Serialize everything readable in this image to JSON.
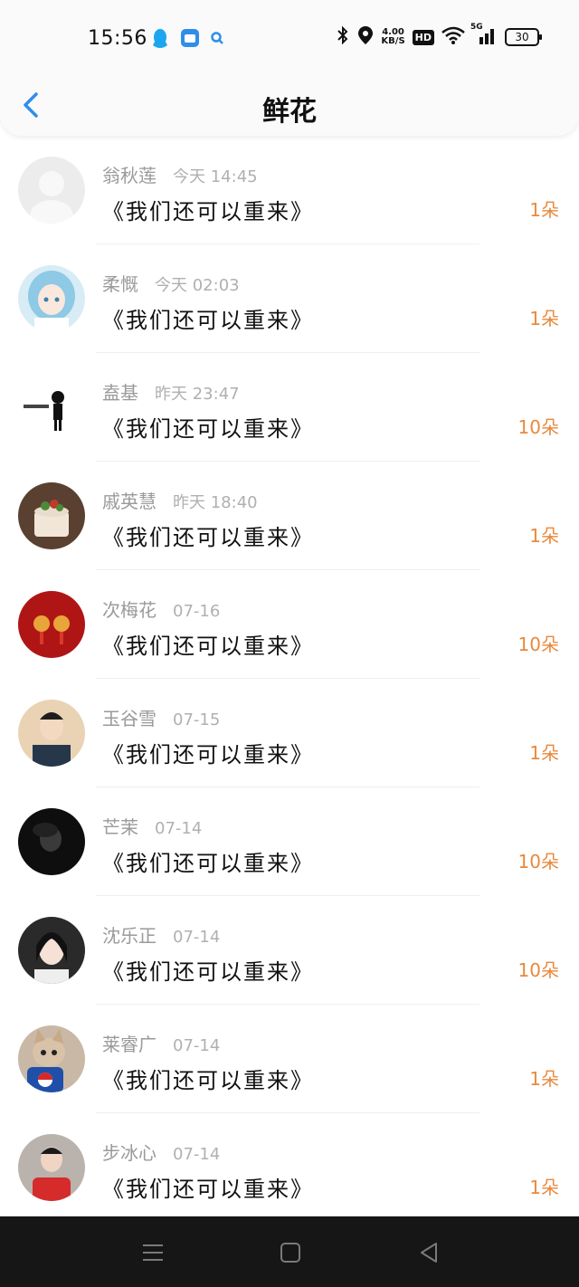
{
  "status_bar": {
    "time": "15:56",
    "net_speed_value": "4.00",
    "net_speed_unit": "KB/S",
    "hd": "HD",
    "network": "5G",
    "battery": "30"
  },
  "header": {
    "title": "鲜花"
  },
  "items": [
    {
      "name": "翁秋莲",
      "date": "今天 14:45",
      "message": "《我们还可以重来》",
      "flowers": "1朵",
      "avatar": "default-avatar"
    },
    {
      "name": "柔慨",
      "date": "今天 02:03",
      "message": "《我们还可以重来》",
      "flowers": "1朵",
      "avatar": "anime-girl-avatar"
    },
    {
      "name": "盍基",
      "date": "昨天 23:47",
      "message": "《我们还可以重来》",
      "flowers": "10朵",
      "avatar": "cartoon-figure-avatar"
    },
    {
      "name": "戚英慧",
      "date": "昨天 18:40",
      "message": "《我们还可以重来》",
      "flowers": "1朵",
      "avatar": "cake-avatar"
    },
    {
      "name": "次梅花",
      "date": "07-16",
      "message": "《我们还可以重来》",
      "flowers": "10朵",
      "avatar": "red-knot-avatar"
    },
    {
      "name": "玉谷雪",
      "date": "07-15",
      "message": "《我们还可以重来》",
      "flowers": "1朵",
      "avatar": "man-portrait-avatar"
    },
    {
      "name": "芒茉",
      "date": "07-14",
      "message": "《我们还可以重来》",
      "flowers": "10朵",
      "avatar": "dark-photo-avatar"
    },
    {
      "name": "沈乐正",
      "date": "07-14",
      "message": "《我们还可以重来》",
      "flowers": "10朵",
      "avatar": "woman-portrait-avatar"
    },
    {
      "name": "莱睿广",
      "date": "07-14",
      "message": "《我们还可以重来》",
      "flowers": "1朵",
      "avatar": "cat-avatar"
    },
    {
      "name": "步冰心",
      "date": "07-14",
      "message": "《我们还可以重来》",
      "flowers": "1朵",
      "avatar": "red-shirt-person-avatar"
    }
  ],
  "colors": {
    "accent_blue": "#2f8ee8",
    "flower_orange": "#e8893c",
    "name_gray": "#9a9a9a",
    "sysnav_bg": "#161616"
  }
}
